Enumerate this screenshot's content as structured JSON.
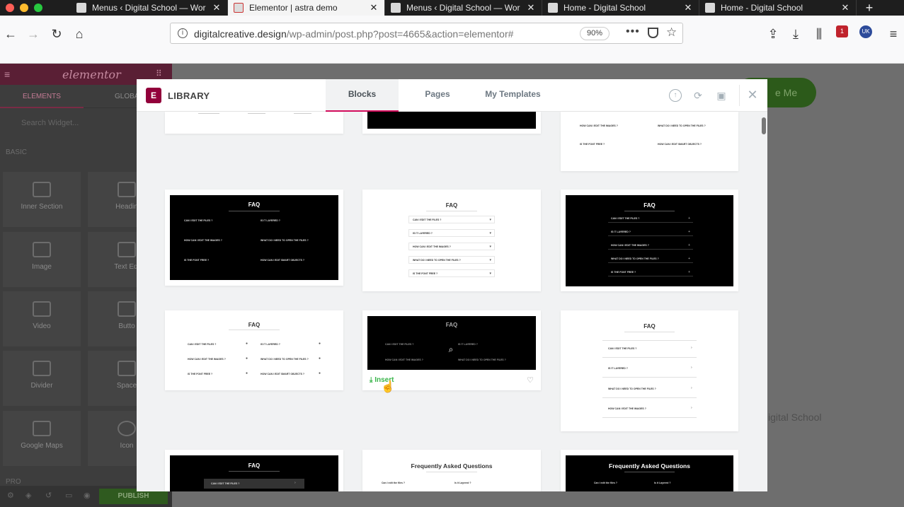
{
  "browser": {
    "tabs": [
      {
        "title": "Menus ‹ Digital School — Wor",
        "active": false
      },
      {
        "title": "Elementor | astra demo",
        "active": true
      },
      {
        "title": "Menus ‹ Digital School — Wor",
        "active": false
      },
      {
        "title": "Home - Digital School",
        "active": false
      },
      {
        "title": "Home - Digital School",
        "active": false
      }
    ],
    "close_glyph": "✕",
    "new_tab_glyph": "+",
    "url_domain": "digitalcreative.design",
    "url_path": "/wp-admin/post.php?post=4665&action=elementor#",
    "zoom": "90%",
    "extension_badge": "1",
    "locale_badge": "UK"
  },
  "editor": {
    "brand": "elementor",
    "tab_elements": "ELEMENTS",
    "tab_global": "GLOBA",
    "search_placeholder": "Search Widget...",
    "section_basic": "BASIC",
    "widgets": [
      "Inner Section",
      "Headin",
      "Image",
      "Text Edi",
      "Video",
      "Butto",
      "Divider",
      "Space",
      "Google Maps",
      "Icon"
    ],
    "section_pro": "PRO",
    "publish": "PUBLISH"
  },
  "canvas": {
    "button_text": "e Me",
    "footer_text": "igital School"
  },
  "library": {
    "title": "LIBRARY",
    "logo_letter": "E",
    "tabs": [
      {
        "label": "Blocks",
        "active": true
      },
      {
        "label": "Pages",
        "active": false
      },
      {
        "label": "My Templates",
        "active": false
      }
    ],
    "icons": [
      "import-icon",
      "sync-icon",
      "save-icon",
      "close-icon"
    ],
    "insert_label": "Insert",
    "cards": {
      "faq": "FAQ",
      "frequently": "Frequently Asked Questions",
      "q1": "CAN I EDIT THE FILES ?",
      "q2": "IS IT LAYERED ?",
      "q3": "HOW CAN I EDIT THE IMAGES ?",
      "q4": "WHAT DO I NEED TO OPEN THE FILES ?",
      "q5": "IS THE FONT FREE ?",
      "q6": "HOW CAN I EDIT SMART OBJECTS ?",
      "q1_mixed": "Can I edit the files ?",
      "q2_mixed": "Is it Layered ?"
    }
  },
  "colors": {
    "accent": "#d30c5c",
    "insert_green": "#39b54a",
    "logo": "#92003b"
  }
}
